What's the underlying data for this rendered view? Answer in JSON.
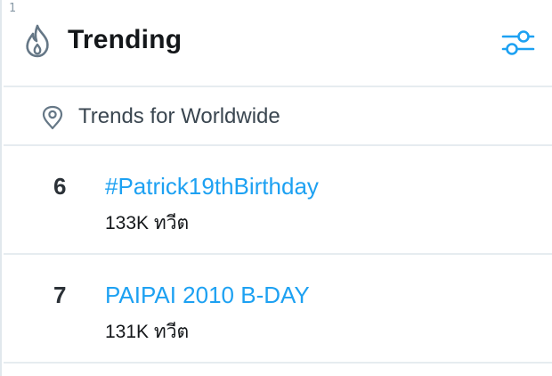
{
  "gutter": {
    "line_number": "1"
  },
  "header": {
    "title": "Trending",
    "icon": "flame-icon",
    "settings_icon": "sliders-icon"
  },
  "location": {
    "icon": "location-pin-icon",
    "label": "Trends for Worldwide"
  },
  "trends": [
    {
      "rank": "6",
      "name": "#Patrick19thBirthday",
      "count": "133K ทวีต"
    },
    {
      "rank": "7",
      "name": "PAIPAI 2010 B-DAY",
      "count": "131K ทวีต"
    }
  ],
  "colors": {
    "accent": "#1da1f2",
    "text": "#14171a",
    "muted_icon": "#657786",
    "divider": "#e6ecf0"
  }
}
